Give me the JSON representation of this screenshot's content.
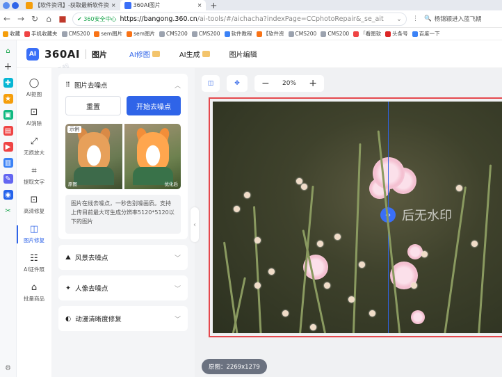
{
  "browser": {
    "tabs": [
      {
        "label": "【软件资讯】-获取最新软件资",
        "active": false,
        "color": "#f59e0b"
      },
      {
        "label": "360AI图片",
        "active": true,
        "color": "#3a6ff7"
      }
    ],
    "new_tab": "+",
    "security_label": "360安全中心",
    "url_host": "https://bangong.360.cn",
    "url_path": "/ai-tools/#/aichacha?indexPage=CCphotoRepair&_se_ait",
    "search_placeholder": "杨锦颖进入蓝飞期",
    "bookmarks": [
      "收藏",
      "手机收藏夹",
      "CMS200",
      "sem图片",
      "sem图片",
      "CMS200",
      "CMS200",
      "软件教程",
      "【软件资",
      "CMS200",
      "CMS200",
      "「看图软",
      "头条号",
      "百度一下"
    ]
  },
  "app": {
    "logo_text": "360AI",
    "logo_badge": "AI",
    "section": "图片",
    "nav": [
      {
        "label": "AI修图",
        "crown": true
      },
      {
        "label": "AI生成",
        "crown": true
      },
      {
        "label": "图片编辑",
        "crown": false
      }
    ],
    "watermark": "星动下载"
  },
  "tools": [
    {
      "label": "AI抠图",
      "icon": "◯",
      "active": false
    },
    {
      "label": "AI消除",
      "icon": "⊡",
      "active": false
    },
    {
      "label": "无损放大",
      "icon": "⤢",
      "active": false
    },
    {
      "label": "提取文字",
      "icon": "⌗",
      "active": false
    },
    {
      "label": "高清修复",
      "icon": "⊡",
      "active": false
    },
    {
      "label": "图片修复",
      "icon": "◫",
      "active": true
    },
    {
      "label": "AI证件照",
      "icon": "☷",
      "active": false
    },
    {
      "label": "批量商品",
      "icon": "⌂",
      "active": false
    }
  ],
  "panel": {
    "denoise": {
      "title": "图片去噪点",
      "reset_label": "重置",
      "start_label": "开始去噪点",
      "example_tag": "示例",
      "before_caption": "原图",
      "after_caption": "优化后",
      "description": "图片在线去噪点，一秒告别噪画质。支持上传目前最大可生成分辨率5120*5120以下的图片"
    },
    "sections": [
      {
        "title": "风景去噪点",
        "icon": "⛰"
      },
      {
        "title": "人像去噪点",
        "icon": "✦"
      },
      {
        "title": "动漫清晰度修复",
        "icon": "◐"
      }
    ]
  },
  "canvas": {
    "zoom": "20%",
    "minus": "−",
    "plus": "+",
    "image_watermark": "后无水印",
    "compare_handle": "‹›",
    "size_label": "原图：2269x1279"
  }
}
